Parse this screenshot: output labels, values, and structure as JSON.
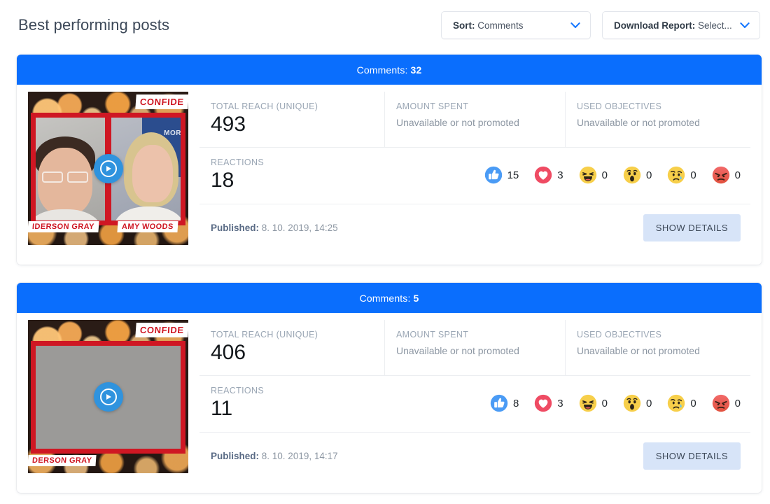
{
  "header": {
    "title": "Best performing posts",
    "sort": {
      "label": "Sort:",
      "value": "Comments",
      "icon": "chevron-down-icon"
    },
    "download": {
      "label": "Download Report:",
      "value": "Select...",
      "icon": "chevron-down-icon"
    }
  },
  "labels": {
    "total_reach": "TOTAL REACH (UNIQUE)",
    "amount_spent": "AMOUNT SPENT",
    "used_objectives": "USED OBJECTIVES",
    "reactions": "REACTIONS",
    "published": "Published:",
    "show_details": "SHOW DETAILS",
    "comments_prefix": "Comments:"
  },
  "colors": {
    "accent_blue": "#0a6efd",
    "title_text": "#3c4858",
    "muted_text": "#8d97a3",
    "label_text": "#9aa6b4",
    "details_btn_bg": "#d7e4f8",
    "like_blue": "#4a9bf5",
    "love_red": "#ef4b63",
    "haha_yellow": "#f7cf4a",
    "wow_yellow": "#f7cf4a",
    "sad_yellow": "#f7cf4a",
    "angry_red": "#ec6a52",
    "play_blue": "#2f93de",
    "thumb_red": "#cf1723"
  },
  "posts": [
    {
      "comments": "32",
      "total_reach": "493",
      "amount_spent": "Unavailable or not promoted",
      "used_objectives": "Unavailable or not promoted",
      "reactions_total": "18",
      "reactions": [
        {
          "name": "like-icon",
          "count": "15"
        },
        {
          "name": "love-icon",
          "count": "3"
        },
        {
          "name": "haha-icon",
          "count": "0"
        },
        {
          "name": "wow-icon",
          "count": "0"
        },
        {
          "name": "sad-icon",
          "count": "0"
        },
        {
          "name": "angry-icon",
          "count": "0"
        }
      ],
      "published_date": "8. 10. 2019, 14:25",
      "thumbnail": {
        "badge": "CONFIDE",
        "layout": "split",
        "name_left": "IDERSON GRAY",
        "name_right": "AMY WOODS",
        "backdrop_text": "MOR",
        "play_icon": "play-button-icon"
      }
    },
    {
      "comments": "5",
      "total_reach": "406",
      "amount_spent": "Unavailable or not promoted",
      "used_objectives": "Unavailable or not promoted",
      "reactions_total": "11",
      "reactions": [
        {
          "name": "like-icon",
          "count": "8"
        },
        {
          "name": "love-icon",
          "count": "3"
        },
        {
          "name": "haha-icon",
          "count": "0"
        },
        {
          "name": "wow-icon",
          "count": "0"
        },
        {
          "name": "sad-icon",
          "count": "0"
        },
        {
          "name": "angry-icon",
          "count": "0"
        }
      ],
      "published_date": "8. 10. 2019, 14:17",
      "thumbnail": {
        "badge": "CONFIDE",
        "layout": "solo",
        "name_left": "DERSON GRAY",
        "name_right": "",
        "backdrop_text": "",
        "play_icon": "play-button-icon"
      }
    }
  ]
}
